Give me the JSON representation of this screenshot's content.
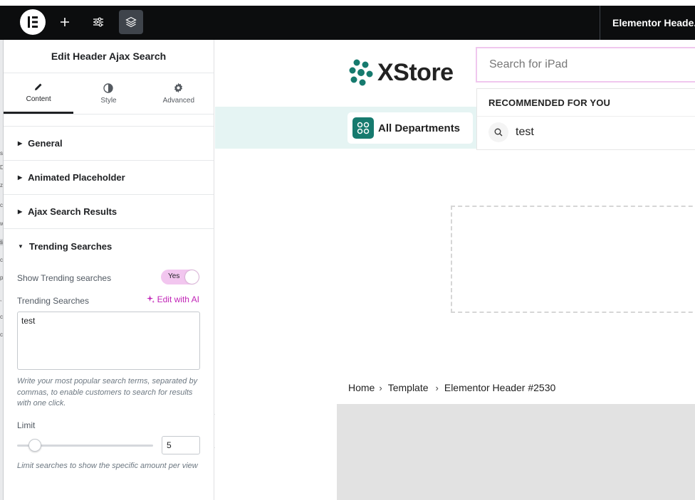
{
  "topbar": {
    "document_title": "Elementor Heade..."
  },
  "panel": {
    "title": "Edit Header Ajax Search",
    "tabs": [
      {
        "label": "Content",
        "icon": "pencil-icon",
        "active": true
      },
      {
        "label": "Style",
        "icon": "contrast-icon",
        "active": false
      },
      {
        "label": "Advanced",
        "icon": "gear-icon",
        "active": false
      }
    ],
    "sections": [
      {
        "label": "General",
        "expanded": false
      },
      {
        "label": "Animated Placeholder",
        "expanded": false
      },
      {
        "label": "Ajax Search Results",
        "expanded": false
      },
      {
        "label": "Trending Searches",
        "expanded": true
      }
    ],
    "trending": {
      "show_label": "Show Trending searches",
      "toggle_value": "Yes",
      "searches_label": "Trending Searches",
      "edit_ai_label": "Edit with AI",
      "searches_value": "test",
      "help_text": "Write your most popular search terms, separated by commas, to enable customers to search for results with one click.",
      "limit_label": "Limit",
      "limit_value": "5",
      "limit_help": "Limit searches to show the specific amount per view"
    }
  },
  "preview": {
    "brand": "XStore",
    "departments_label": "All Departments",
    "search_placeholder": "Search for iPad",
    "dropdown_heading": "RECOMMENDED FOR YOU",
    "dropdown_item": "test",
    "breadcrumb": [
      "Home",
      "Template",
      "Elementor Header #2530"
    ]
  },
  "colors": {
    "accent_pink": "#c124b7",
    "toggle_bg": "#f2c6ef",
    "brand_green": "#167a6e",
    "navband": "#e5f4f3",
    "topbar": "#0c0d0e"
  }
}
